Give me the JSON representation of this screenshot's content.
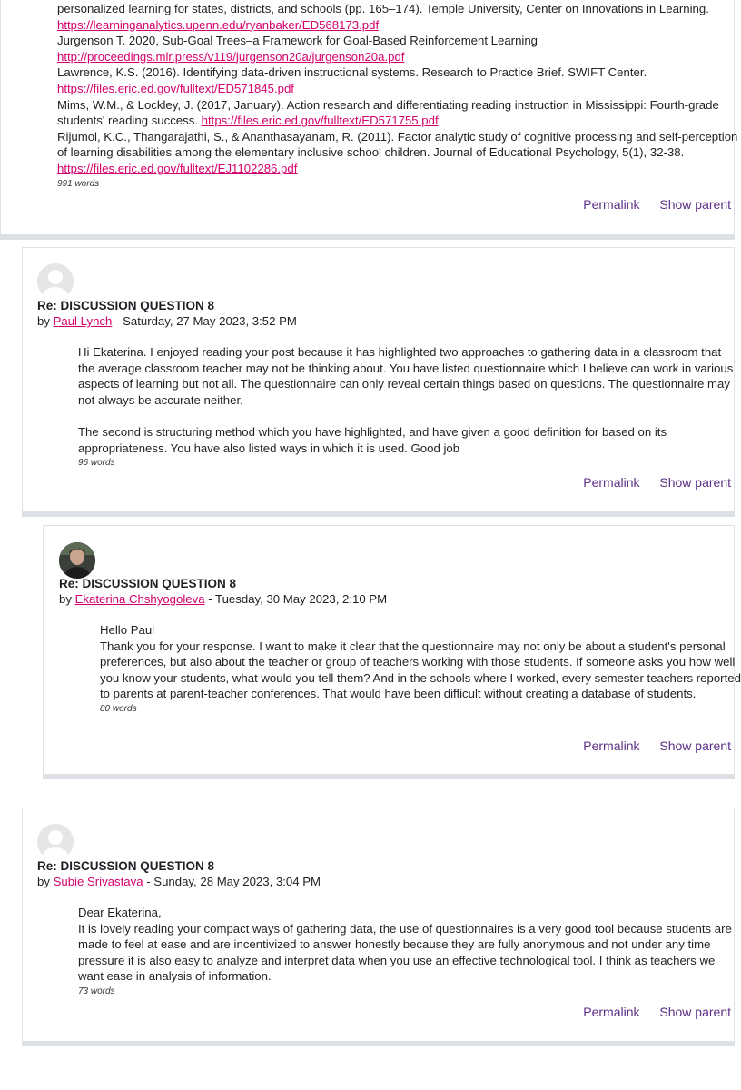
{
  "top_post": {
    "references": [
      {
        "text": "personalized learning for states, districts, and schools (pp. 165–174). Temple University, Center on Innovations in Learning. ",
        "link": "https://learninganalytics.upenn.edu/ryanbaker/ED568173.pdf"
      },
      {
        "text": "Jurgenson T. 2020, Sub-Goal Trees–a Framework for Goal-Based Reinforcement Learning ",
        "link": "http://proceedings.mlr.press/v119/jurgenson20a/jurgenson20a.pdf"
      },
      {
        "text": "Lawrence, K.S. (2016). Identifying data-driven instructional systems. Research to Practice Brief. SWIFT Center. ",
        "link": "https://files.eric.ed.gov/fulltext/ED571845.pdf"
      },
      {
        "text": "Mims, W.M., & Lockley, J. (2017, January). Action research and differentiating reading instruction in Mississippi: Fourth-grade students' reading success. ",
        "link": "https://files.eric.ed.gov/fulltext/ED571755.pdf"
      },
      {
        "text": "Rijumol, K.C., Thangarajathi, S., & Ananthasayanam, R. (2011). Factor analytic study of cognitive processing and self-perception of learning disabilities among the elementary inclusive school children. Journal of Educational Psychology, 5(1), 32-38. ",
        "link": "https://files.eric.ed.gov/fulltext/EJ1102286.pdf"
      }
    ],
    "word_count": "991 words",
    "permalink": "Permalink",
    "show_parent": "Show parent"
  },
  "posts": [
    {
      "subject": "Re: DISCUSSION QUESTION 8",
      "by": "by ",
      "author": "Paul Lynch",
      "date": " - Saturday, 27 May 2023, 3:52 PM",
      "paragraphs": [
        "Hi Ekaterina. I enjoyed reading your post because it has highlighted two approaches to gathering data in a classroom that the average classroom teacher may not be thinking about. You have listed questionnaire which I believe can work in various aspects of learning but not all. The questionnaire can only reveal certain things based on questions. The questionnaire may not always be accurate neither.",
        "The second is structuring method which you have highlighted, and have given a good definition for based on its appropriateness. You have also listed ways in which it is used. Good job"
      ],
      "word_count": "96 words",
      "permalink": "Permalink",
      "show_parent": "Show parent"
    },
    {
      "subject": "Re: DISCUSSION QUESTION 8",
      "by": "by ",
      "author": "Ekaterina Chshyogoleva",
      "date": " - Tuesday, 30 May 2023, 2:10 PM",
      "paragraphs": [
        "Hello Paul",
        "Thank you for your response. I want to make it clear that the questionnaire may not only be about a student's personal preferences, but also about the teacher or group of teachers working with those students. If someone asks you how well you know your students, what would you tell them? And in the schools where I worked, every semester teachers reported to parents at parent-teacher conferences. That would have been difficult without creating a database of students."
      ],
      "word_count": "80 words",
      "permalink": "Permalink",
      "show_parent": "Show parent"
    },
    {
      "subject": "Re: DISCUSSION QUESTION 8",
      "by": "by ",
      "author": "Subie Srivastava",
      "date": " - Sunday, 28 May 2023, 3:04 PM",
      "paragraphs": [
        "Dear Ekaterina,",
        "It is lovely reading your compact ways of gathering data, the use of questionnaires is a very good tool because students are made to feel at ease and are incentivized to answer honestly because they are fully anonymous and not under any time pressure it is also easy to analyze and interpret data when you use an effective technological tool. I think as teachers we want ease in analysis of information."
      ],
      "word_count": "73 words",
      "permalink": "Permalink",
      "show_parent": "Show parent"
    }
  ]
}
